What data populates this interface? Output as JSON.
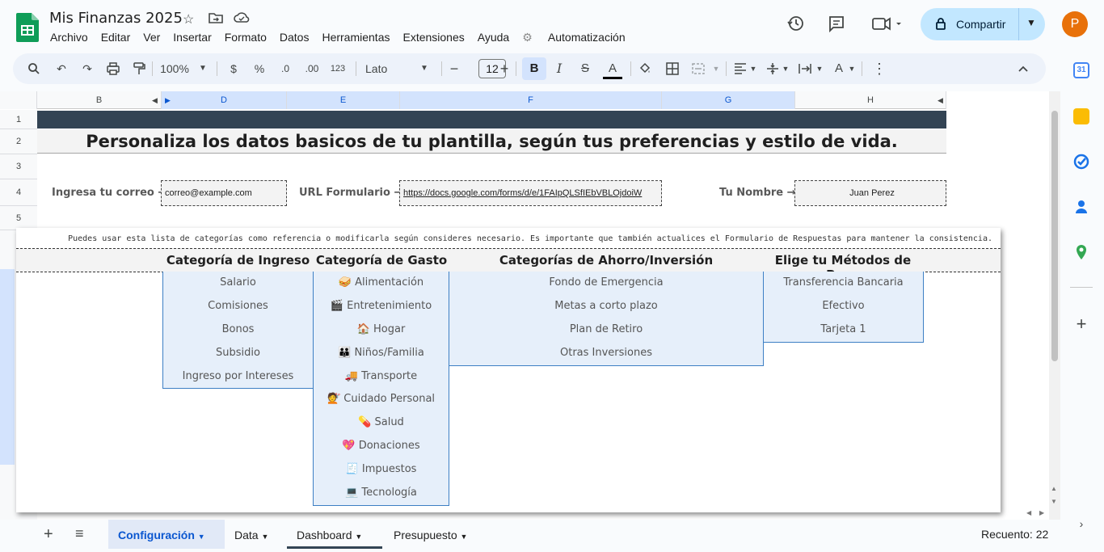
{
  "app": {
    "title": "Mis Finanzas 2025",
    "menu": [
      "Archivo",
      "Editar",
      "Ver",
      "Insertar",
      "Formato",
      "Datos",
      "Herramientas",
      "Extensiones",
      "Ayuda",
      "Automatización"
    ],
    "share_label": "Compartir",
    "avatar_letter": "P",
    "brand_color": "#0f9d58",
    "accent_color": "#c2e7ff"
  },
  "toolbar": {
    "zoom": "100%",
    "currency": "$",
    "percent": "%",
    "dec_decrease": ".0",
    "dec_increase": ".00",
    "number_format": "123",
    "font": "Lato",
    "font_size": "12",
    "bold": "B",
    "italic": "I",
    "strike": "S",
    "text_color": "A"
  },
  "grid": {
    "columns": [
      "B",
      "D",
      "E",
      "F",
      "G",
      "H"
    ],
    "rows": [
      "1",
      "2",
      "3",
      "4",
      "5"
    ],
    "headline": "Personaliza los datos basicos de tu plantilla, según tus preferencias y estilo de vida.",
    "fields": {
      "email_label": "Ingresa tu correo",
      "email_value": "correo@example.com",
      "form_label": "URL Formulario",
      "form_value": "https://docs.google.com/forms/d/e/1FAIpQLSfIEbVBLOjdoiW",
      "name_label": "Tu Nombre",
      "name_value": "Juan Perez"
    }
  },
  "categories": {
    "note": "Puedes usar esta lista de categorías como referencia o modificarla según consideres necesario. Es importante que también actualices el Formulario de Respuestas para mantener la consistencia.",
    "ingreso": {
      "title": "Categoría de Ingreso",
      "items": [
        "Salario",
        "Comisiones",
        "Bonos",
        "Subsidio",
        "Ingreso por Intereses"
      ]
    },
    "gasto": {
      "title": "Categoría de Gasto",
      "items": [
        "🥪 Alimentación",
        "🎬 Entretenimiento",
        "🏠 Hogar",
        "👪 Niños/Familia",
        "🚚 Transporte",
        "💇 Cuidado Personal",
        "💊 Salud",
        "💖 Donaciones",
        "🧾 Impuestos",
        "💻 Tecnología"
      ]
    },
    "ahorro": {
      "title": "Categorías de Ahorro/Inversión",
      "items": [
        "Fondo de Emergencia",
        "Metas a corto plazo",
        "Plan de Retiro",
        "Otras Inversiones"
      ]
    },
    "pago": {
      "title": "Elige tu Métodos de Pago",
      "items": [
        "Transferencia Bancaria",
        "Efectivo",
        "Tarjeta 1"
      ]
    }
  },
  "sheets": {
    "tabs": [
      "Configuración",
      "Data",
      "Dashboard",
      "Presupuesto"
    ],
    "active": "Configuración",
    "summary": "Recuento: 22"
  }
}
